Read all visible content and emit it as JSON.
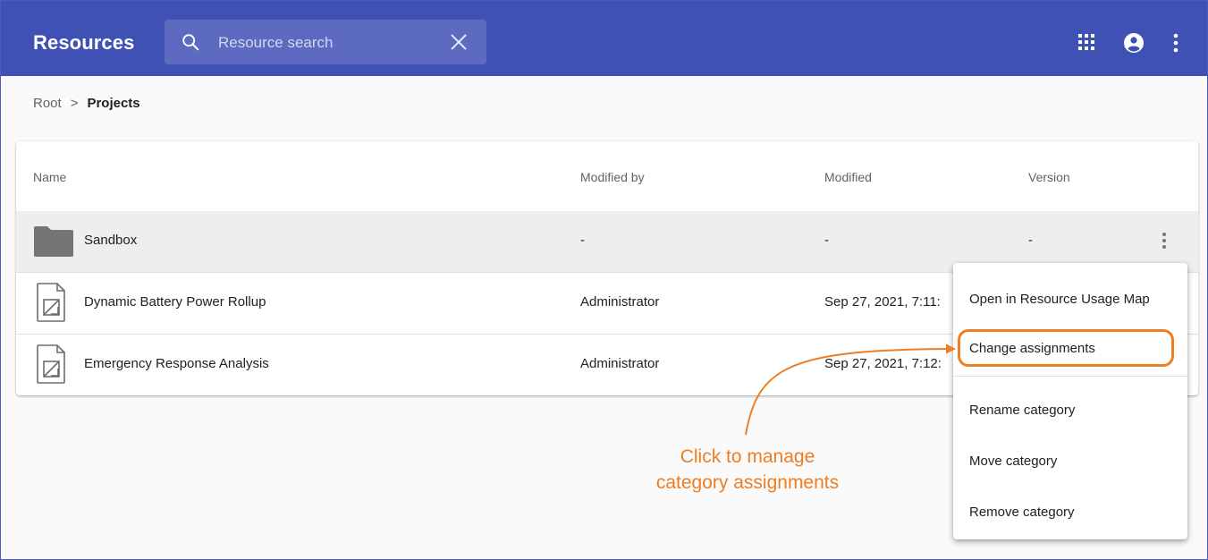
{
  "header": {
    "title": "Resources",
    "search": {
      "placeholder": "Resource search",
      "value": ""
    }
  },
  "icons": {
    "search": "search-icon",
    "clear": "close-icon",
    "apps": "apps-grid-icon",
    "account": "account-circle-icon",
    "more": "more-vert-icon",
    "folder": "folder-icon",
    "document": "document-icon"
  },
  "breadcrumb": {
    "root": "Root",
    "separator": ">",
    "current": "Projects"
  },
  "table": {
    "columns": [
      "Name",
      "Modified by",
      "Modified",
      "Version"
    ],
    "rows": [
      {
        "name": "Sandbox",
        "modified_by": "-",
        "modified": "-",
        "version": "-",
        "type": "folder"
      },
      {
        "name": "Dynamic Battery Power Rollup",
        "modified_by": "Administrator",
        "modified": "Sep 27, 2021, 7:11:",
        "version": "",
        "type": "document"
      },
      {
        "name": "Emergency Response Analysis",
        "modified_by": "Administrator",
        "modified": "Sep 27, 2021, 7:12:",
        "version": "",
        "type": "document"
      }
    ]
  },
  "menu": {
    "items": [
      {
        "label": "Open in Resource Usage Map"
      },
      {
        "label": "Change assignments",
        "highlighted": true
      },
      {
        "label": "Rename category"
      },
      {
        "label": "Move category"
      },
      {
        "label": "Remove category"
      }
    ]
  },
  "annotation": {
    "line1": "Click to manage",
    "line2": "category assignments"
  },
  "colors": {
    "appbar": "#3f51b5",
    "search_bg": "#5c6bc0",
    "accent_orange": "#ef7d22",
    "selected_row": "#eeeeee",
    "folder": "#757575"
  }
}
